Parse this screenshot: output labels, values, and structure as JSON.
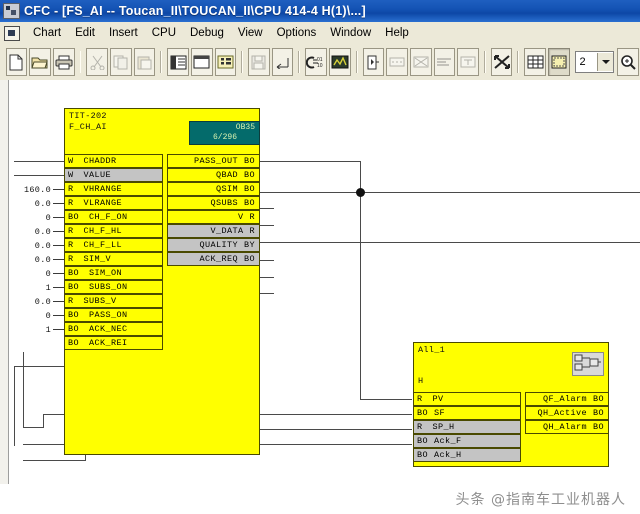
{
  "window": {
    "title": "CFC - [FS_AI -- Toucan_II\\TOUCAN_II\\CPU 414-4 H(1)\\...]",
    "icon": "cfc-app-icon"
  },
  "menubar": {
    "app_icon": "chart-icon",
    "items": [
      {
        "label": "Chart"
      },
      {
        "label": "Edit"
      },
      {
        "label": "Insert"
      },
      {
        "label": "CPU"
      },
      {
        "label": "Debug"
      },
      {
        "label": "View"
      },
      {
        "label": "Options"
      },
      {
        "label": "Window"
      },
      {
        "label": "Help"
      }
    ]
  },
  "toolbar": {
    "zoom_value": "2",
    "buttons": [
      {
        "name": "new-chart-button",
        "icon": "new-document-icon",
        "state": "enabled"
      },
      {
        "name": "open-chart-button",
        "icon": "open-folder-icon",
        "state": "enabled"
      },
      {
        "name": "print-button",
        "icon": "printer-icon",
        "state": "enabled"
      },
      {
        "name": "cut-button",
        "icon": "scissors-icon",
        "state": "disabled"
      },
      {
        "name": "copy-button",
        "icon": "copy-icon",
        "state": "disabled"
      },
      {
        "name": "paste-button",
        "icon": "paste-icon",
        "state": "disabled"
      },
      {
        "name": "sheet-view-button",
        "icon": "sheet-view-icon",
        "state": "framed"
      },
      {
        "name": "overview-button",
        "icon": "overview-window-icon",
        "state": "framed"
      },
      {
        "name": "catalog-button",
        "icon": "catalog-list-icon",
        "state": "framed"
      },
      {
        "name": "save-compile-button",
        "icon": "save-disk-icon",
        "state": "disabled"
      },
      {
        "name": "download-button",
        "icon": "download-arrow-icon",
        "state": "enabled"
      },
      {
        "name": "compile-button",
        "icon": "compile-0110-icon",
        "state": "enabled"
      },
      {
        "name": "test-mode-button",
        "icon": "test-mode-icon",
        "state": "enabled"
      },
      {
        "name": "monitor-button",
        "icon": "monitor-icon",
        "state": "enabled"
      },
      {
        "name": "insert-input-button",
        "icon": "insert-input-icon",
        "state": "disabled"
      },
      {
        "name": "insert-cross-button",
        "icon": "insert-cross-icon",
        "state": "disabled"
      },
      {
        "name": "align-button",
        "icon": "align-icon",
        "state": "disabled"
      },
      {
        "name": "text-button",
        "icon": "text-icon",
        "state": "disabled"
      },
      {
        "name": "optimize-button",
        "icon": "optimize-arrows-icon",
        "state": "enabled"
      },
      {
        "name": "grid-button",
        "icon": "grid-table-icon",
        "state": "enabled"
      },
      {
        "name": "sheet-bar-button",
        "icon": "sheet-frame-icon",
        "state": "pressed"
      },
      {
        "name": "zoom-in-button",
        "icon": "magnifier-plus-icon",
        "state": "enabled"
      }
    ]
  },
  "chart": {
    "blocks": [
      {
        "id": "block-tit-202",
        "name": "TIT-202",
        "type": "F_CH_AI",
        "runtime_badge": {
          "ob": "OB35",
          "position": "6/296"
        },
        "inputs": [
          {
            "type": "W",
            "name": "CHADDR",
            "value": "",
            "wired": true
          },
          {
            "type": "W",
            "name": "VALUE",
            "value": "",
            "wired": true,
            "highlight": true
          },
          {
            "type": "R",
            "name": "VHRANGE",
            "value": "160.0",
            "wired": false
          },
          {
            "type": "R",
            "name": "VLRANGE",
            "value": "0.0",
            "wired": false
          },
          {
            "type": "BO",
            "name": "CH_F_ON",
            "value": "0",
            "wired": false
          },
          {
            "type": "R",
            "name": "CH_F_HL",
            "value": "0.0",
            "wired": false
          },
          {
            "type": "R",
            "name": "CH_F_LL",
            "value": "0.0",
            "wired": false
          },
          {
            "type": "R",
            "name": "SIM_V",
            "value": "0.0",
            "wired": false
          },
          {
            "type": "BO",
            "name": "SIM_ON",
            "value": "0",
            "wired": false
          },
          {
            "type": "BO",
            "name": "SUBS_ON",
            "value": "1",
            "wired": false
          },
          {
            "type": "R",
            "name": "SUBS_V",
            "value": "0.0",
            "wired": false
          },
          {
            "type": "BO",
            "name": "PASS_ON",
            "value": "0",
            "wired": false
          },
          {
            "type": "BO",
            "name": "ACK_NEC",
            "value": "1",
            "wired": false
          },
          {
            "type": "BO",
            "name": "ACK_REI",
            "value": "",
            "wired": true
          }
        ],
        "outputs": [
          {
            "name": "PASS_OUT",
            "type": "BO",
            "highlight": false
          },
          {
            "name": "QBAD",
            "type": "BO",
            "highlight": false
          },
          {
            "name": "QSIM",
            "type": "BO",
            "highlight": false
          },
          {
            "name": "QSUBS",
            "type": "BO",
            "highlight": false
          },
          {
            "name": "V",
            "type": "R",
            "highlight": false
          },
          {
            "name": "V_DATA",
            "type": "R",
            "highlight": true
          },
          {
            "name": "QUALITY",
            "type": "BY",
            "highlight": true
          },
          {
            "name": "ACK_REQ",
            "type": "BO",
            "highlight": true
          }
        ]
      },
      {
        "id": "block-all-1",
        "name": "All_1",
        "type": "H",
        "icon": "block-logic-icon",
        "inputs": [
          {
            "type": "R",
            "name": "PV",
            "highlight": false
          },
          {
            "type": "BO",
            "name": "SF",
            "highlight": false
          },
          {
            "type": "R",
            "name": "SP_H",
            "highlight": true
          },
          {
            "type": "BO",
            "name": "Ack_F",
            "highlight": true
          },
          {
            "type": "BO",
            "name": "Ack_H",
            "highlight": true
          }
        ],
        "outputs": [
          {
            "name": "QF_Alarm",
            "type": "BO"
          },
          {
            "name": "QH_Active",
            "type": "BO"
          },
          {
            "name": "QH_Alarm",
            "type": "BO"
          }
        ]
      }
    ],
    "colors": {
      "block_fill": "#ffff00",
      "block_border": "#4a4a00",
      "pin_highlight": "#c4c4c4",
      "badge_fill": "#046b6b",
      "wire": "#4a4a4a"
    }
  },
  "watermark": {
    "text": "头条 @指南车工业机器人"
  }
}
